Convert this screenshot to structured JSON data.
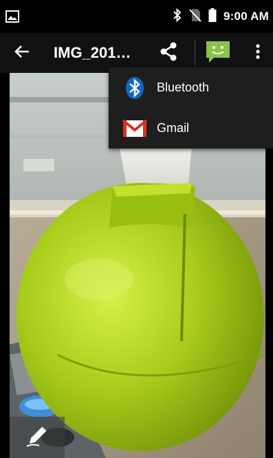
{
  "status_bar": {
    "time": "9:00 AM",
    "icons": [
      "gallery-icon",
      "bluetooth-icon",
      "no-sim-icon",
      "battery-icon"
    ]
  },
  "action_bar": {
    "title": "IMG_201…",
    "back_icon": "arrow-back-icon",
    "share_icon": "share-icon",
    "messaging_icon": "messaging-icon",
    "overflow_icon": "more-vert-icon"
  },
  "share_menu": {
    "items": [
      {
        "label": "Bluetooth",
        "icon": "bluetooth-icon"
      },
      {
        "label": "Gmail",
        "icon": "gmail-icon"
      }
    ]
  },
  "edit": {
    "icon": "pencil-edit-icon"
  },
  "colors": {
    "status_bar_bg": "#000000",
    "action_bar_bg": "#111111",
    "menu_bg": "#1e1e1e",
    "messaging_green": "#8bc34a",
    "bluetooth_blue": "#1565c0",
    "gmail_red": "#d93025"
  }
}
